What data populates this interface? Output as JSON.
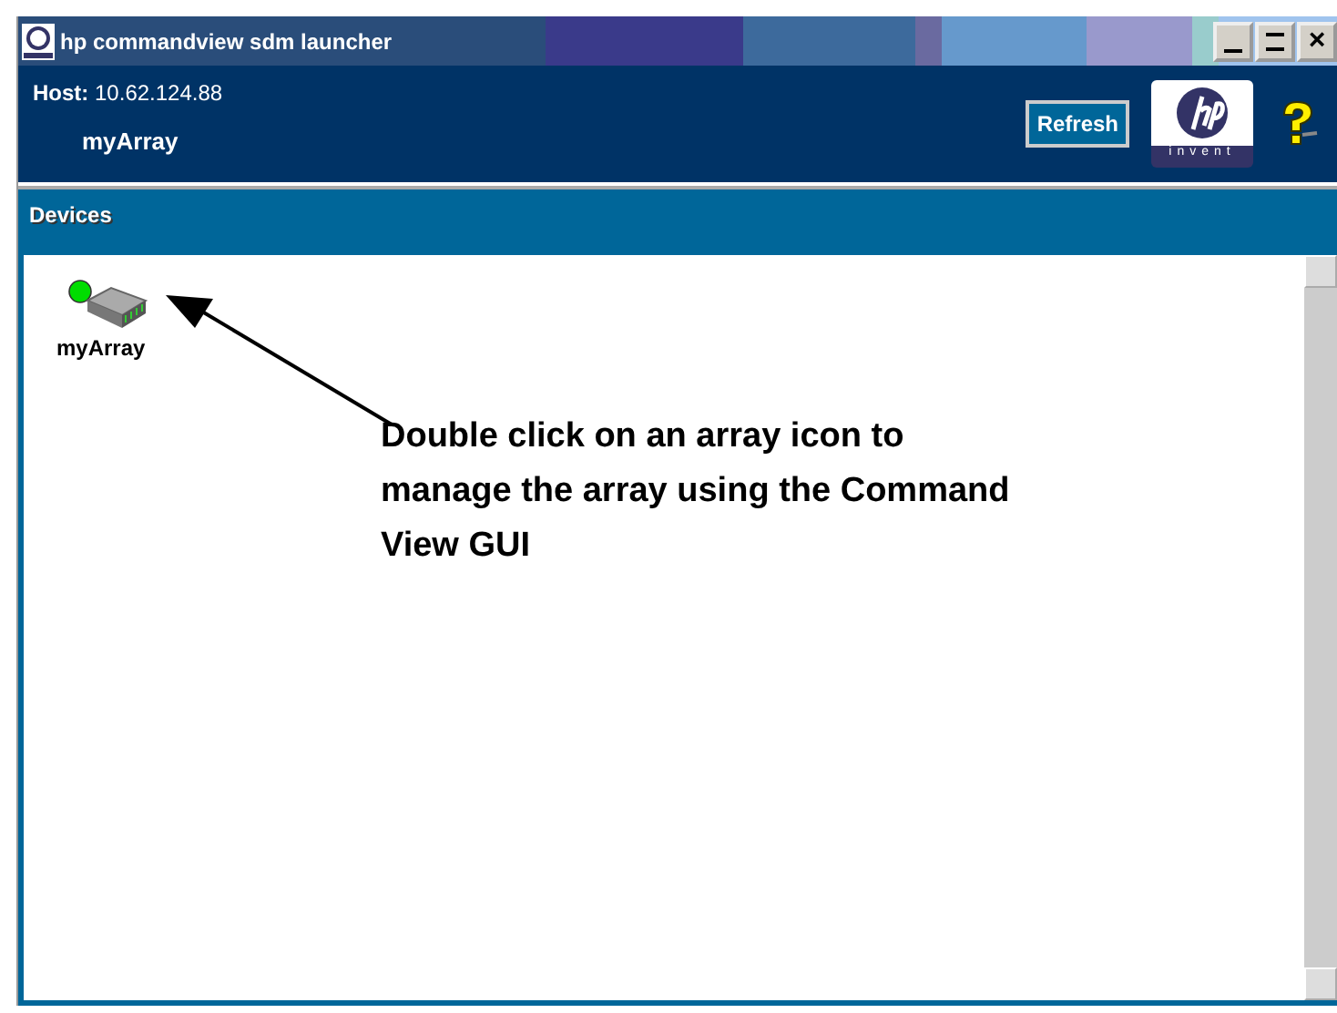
{
  "window": {
    "title": "hp commandview sdm launcher",
    "controls": [
      {
        "kind": "minimize"
      },
      {
        "kind": "maximize"
      },
      {
        "kind": "close",
        "label": "×"
      }
    ]
  },
  "header": {
    "host_label": "Host:",
    "host": "10.62.124.88",
    "array": "myArray",
    "refresh_button": "Refresh",
    "logo_caption": "invent"
  },
  "panel": {
    "title": "Devices",
    "devices": [
      {
        "name": "myArray",
        "color": "#00dd00"
      }
    ]
  },
  "annotation": {
    "text": "Double click on an array icon to manage the array using the Command View GUI"
  }
}
